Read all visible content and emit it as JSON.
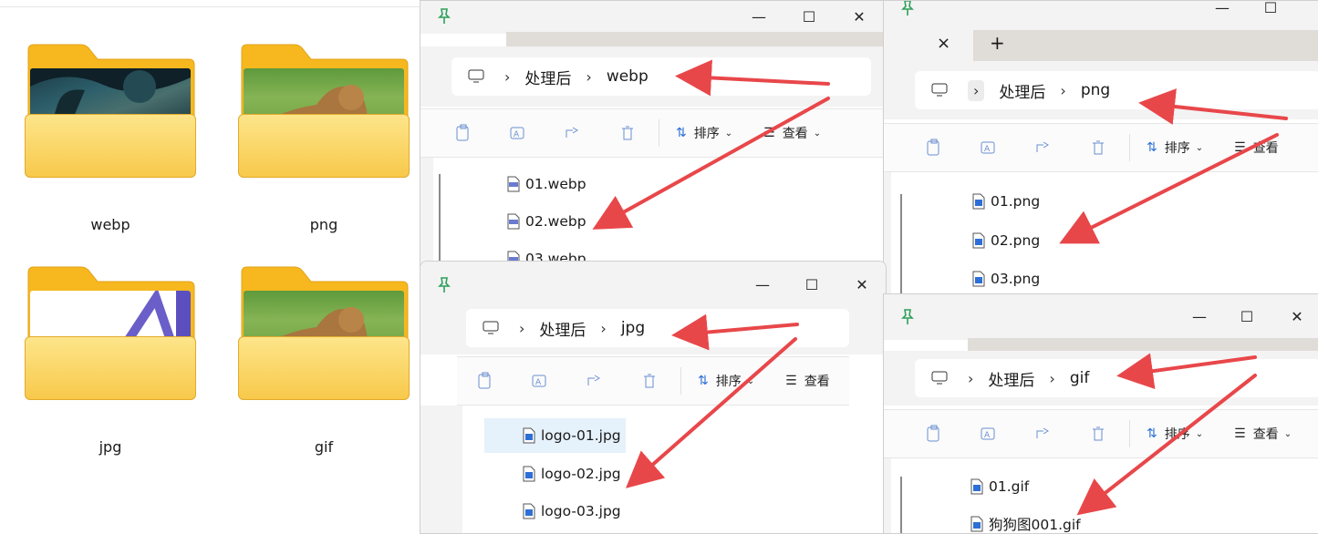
{
  "folders": [
    {
      "label": "webp",
      "photo": "forest"
    },
    {
      "label": "png",
      "photo": "lion"
    },
    {
      "label": "jpg",
      "photo": "logo"
    },
    {
      "label": "gif",
      "photo": "lion"
    }
  ],
  "windows": {
    "webp": {
      "crumbs": [
        "处理后",
        "webp"
      ],
      "files": [
        "01.webp",
        "02.webp",
        "03.webp"
      ]
    },
    "png": {
      "crumbs": [
        "处理后",
        "png"
      ],
      "files": [
        "01.png",
        "02.png",
        "03.png"
      ],
      "tab_close": "×",
      "tab_add": "+"
    },
    "jpg": {
      "crumbs": [
        "处理后",
        "jpg"
      ],
      "files": [
        "logo-01.jpg",
        "logo-02.jpg",
        "logo-03.jpg"
      ]
    },
    "gif": {
      "crumbs": [
        "处理后",
        "gif"
      ],
      "files": [
        "01.gif",
        "狗狗图001.gif"
      ]
    }
  },
  "toolbar": {
    "sort_label": "排序",
    "view_label": "查看"
  },
  "colors": {
    "arrow": "#e8474a",
    "pin": "#2ea05a",
    "accent": "#2d6fd6"
  }
}
